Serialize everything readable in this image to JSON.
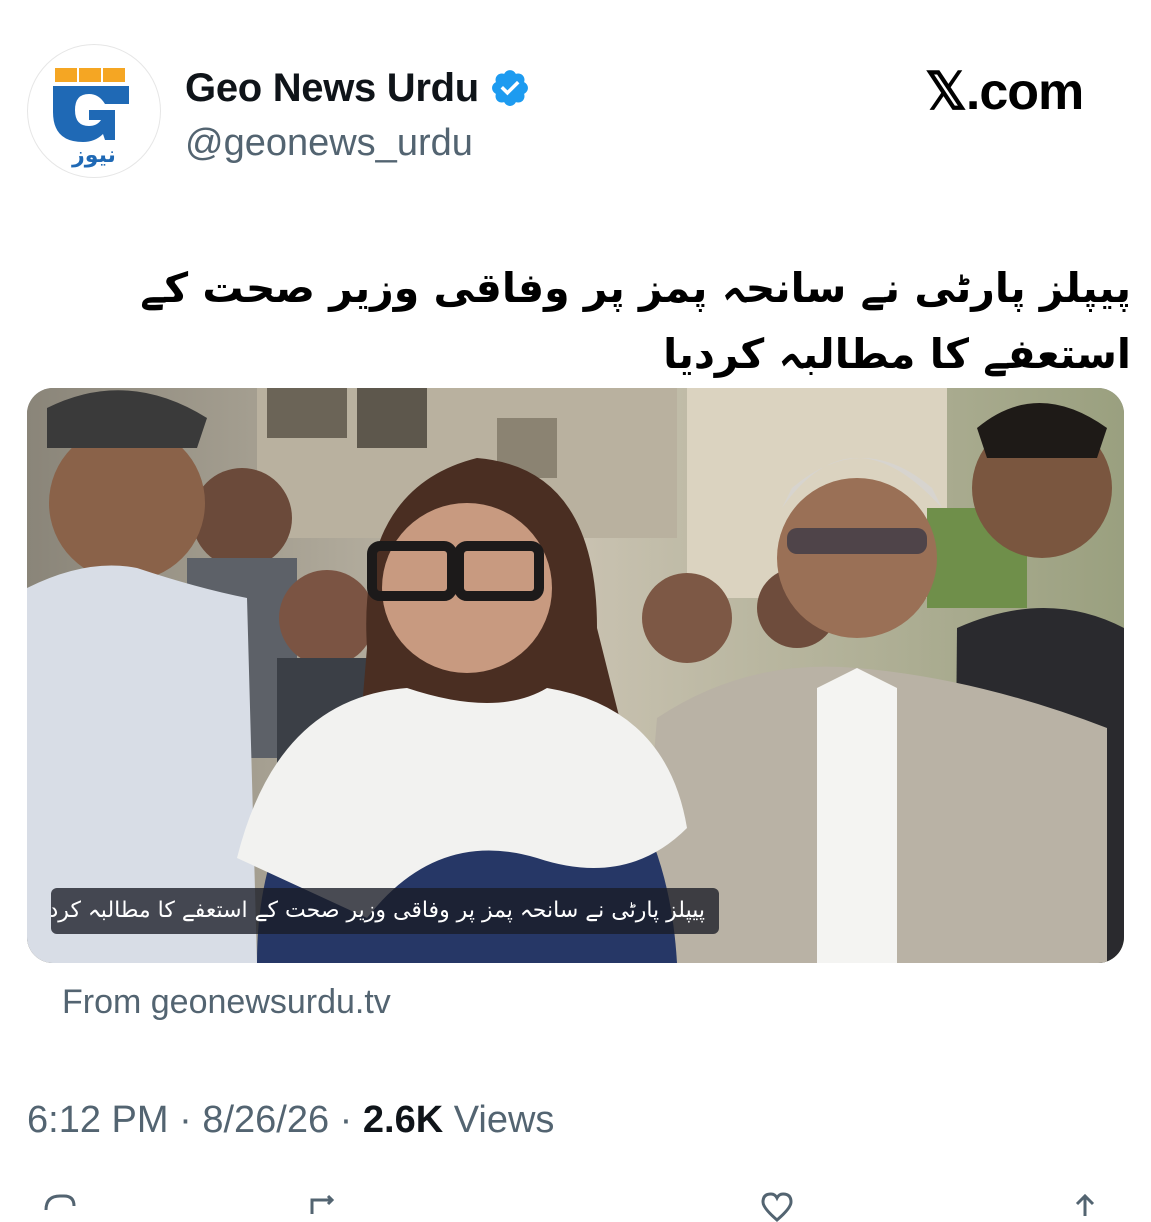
{
  "tweet": {
    "display_name": "Geo News Urdu",
    "handle": "@geonews_urdu",
    "platform": "𝕏.com",
    "headline": "پیپلز پارٹی نے سانحہ پمز پر وفاقی وزیر صحت کے استعفے کا مطالبہ کردیا",
    "video_caption": "پیپلز پارٹی نے سانحہ پمز پر وفاقی وزیر صحت کے استعفے کا مطالبہ کردیا",
    "source": "From geonewsurdu.tv",
    "time": "6:12 PM",
    "sep1": " · ",
    "date": "8/26/26",
    "sep2": " · ",
    "views_count": "2.6K",
    "views_label": "Views",
    "logo_text": "نیوز"
  },
  "colors": {
    "verified": "#1d9bf0",
    "brand_blue": "#1f69b5",
    "brand_orange": "#f5a623",
    "muted": "#536471"
  },
  "icons": [
    "verified-badge-icon",
    "geo-news-logo",
    "x-logo",
    "reply-icon",
    "repost-icon",
    "like-icon",
    "share-icon"
  ]
}
